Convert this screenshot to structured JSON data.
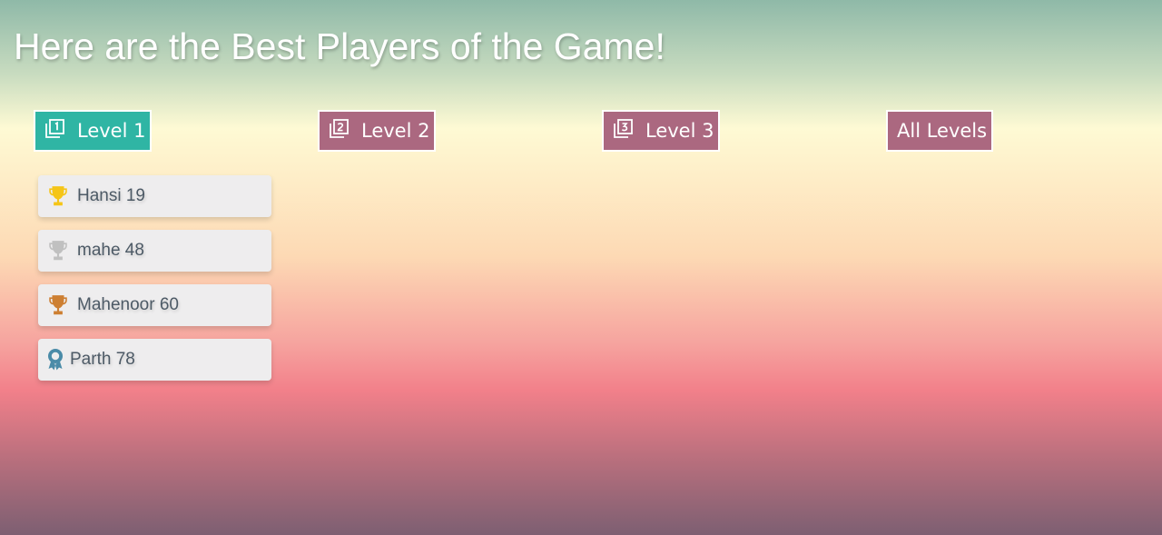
{
  "page": {
    "title": "Here are the Best Players of the Game!"
  },
  "tabs": [
    {
      "label": "Level 1",
      "icon": "level-1-icon",
      "color": "#2fb5a4",
      "active": true
    },
    {
      "label": "Level 2",
      "icon": "level-2-icon",
      "color": "#ab6880",
      "active": false
    },
    {
      "label": "Level 3",
      "icon": "level-3-icon",
      "color": "#ab6880",
      "active": false
    },
    {
      "label": "All Levels",
      "icon": "",
      "color": "#ab6880",
      "active": false
    }
  ],
  "players": [
    {
      "name": "Hansi",
      "score": "19",
      "text": "Hansi 19",
      "icon": "gold-trophy-icon",
      "icon_color": "#f5c518"
    },
    {
      "name": "mahe",
      "score": "48",
      "text": "mahe 48",
      "icon": "silver-trophy-icon",
      "icon_color": "#c0c0c0"
    },
    {
      "name": "Mahenoor",
      "score": "60",
      "text": "Mahenoor 60",
      "icon": "bronze-trophy-icon",
      "icon_color": "#cd7f32"
    },
    {
      "name": "Parth",
      "score": "78",
      "text": "Parth 78",
      "icon": "award-ribbon-icon",
      "icon_color": "#4a8ba8"
    }
  ]
}
